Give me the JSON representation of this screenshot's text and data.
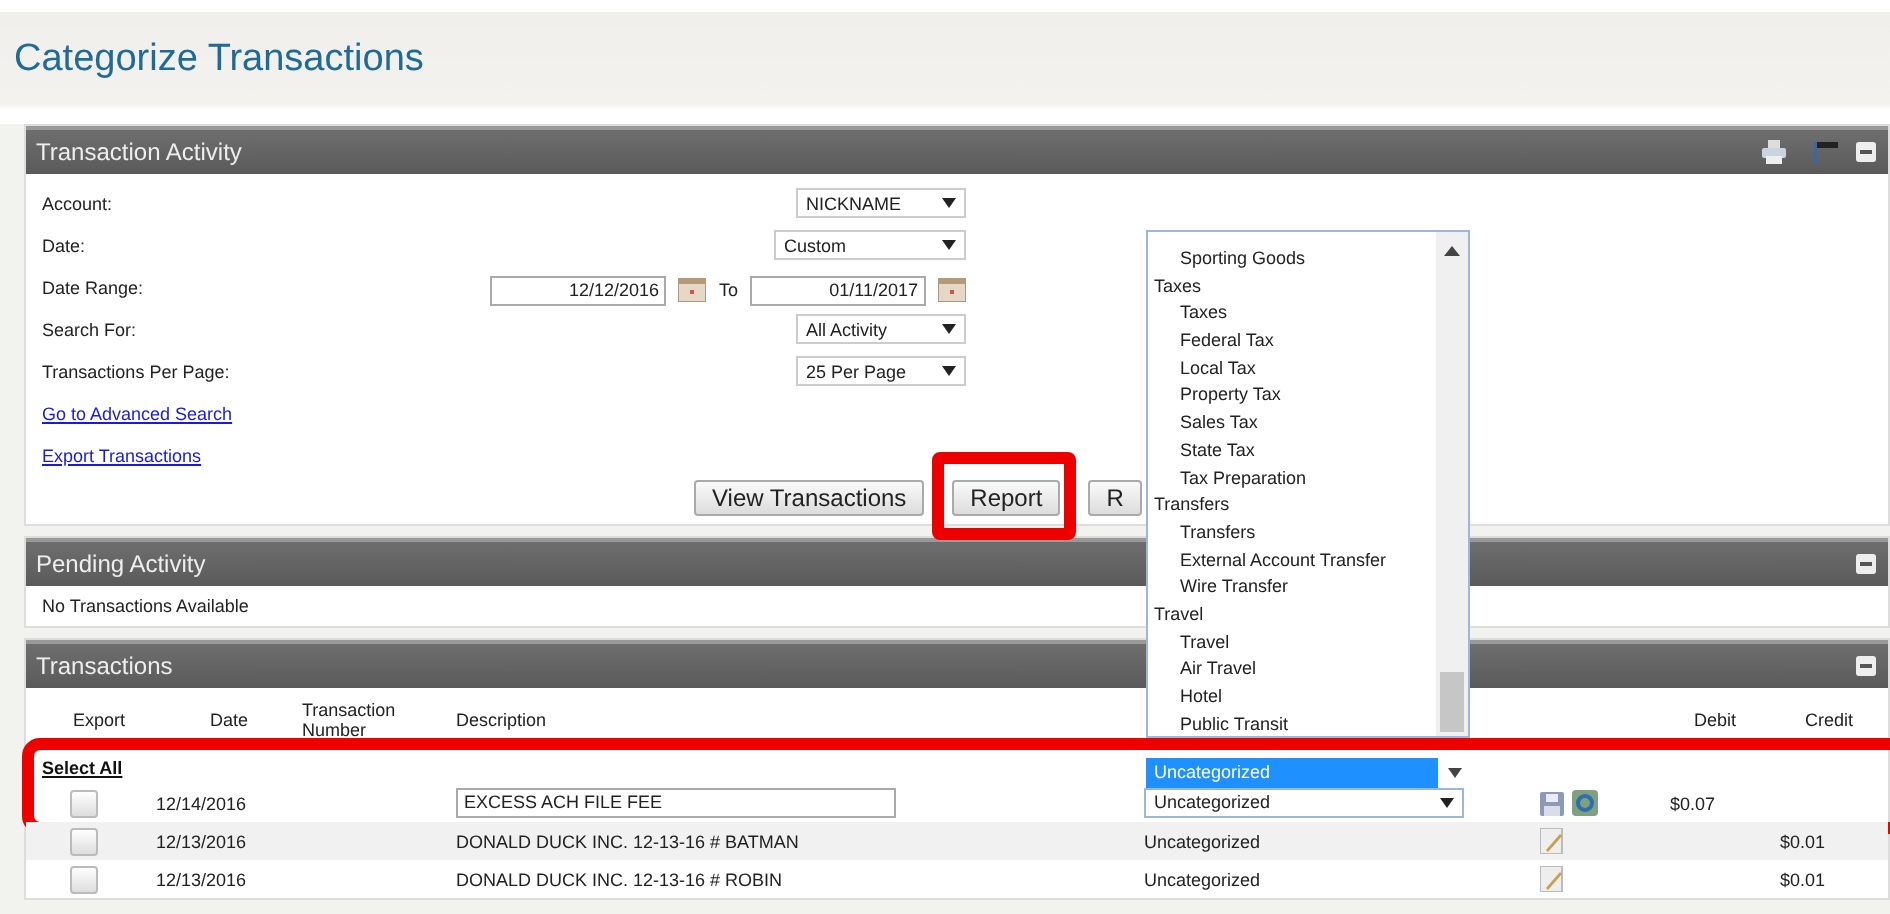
{
  "page_title": "Categorize Transactions",
  "activity": {
    "title": "Transaction Activity",
    "fields": [
      {
        "kind": "select",
        "label": "Account:",
        "value": "NICKNAME"
      },
      {
        "kind": "select",
        "label": "Date:",
        "value": "Custom"
      },
      {
        "kind": "range",
        "label": "Date Range:",
        "from": "12/12/2016",
        "connector": "To",
        "to": "01/11/2017"
      },
      {
        "kind": "select",
        "label": "Search For:",
        "value": "All Activity"
      },
      {
        "kind": "select",
        "label": "Transactions Per Page:",
        "value": "25 Per Page"
      }
    ],
    "links": [
      "Go to Advanced Search",
      "Export Transactions"
    ],
    "buttons": [
      {
        "label": "View Transactions",
        "highlighted": false
      },
      {
        "label": "Report",
        "highlighted": true
      },
      {
        "label": "R",
        "highlighted": false
      }
    ]
  },
  "pending": {
    "title": "Pending Activity",
    "message": "No Transactions Available"
  },
  "transactions": {
    "title": "Transactions",
    "columns": [
      "Export",
      "Date",
      "Transaction Number",
      "Description",
      "Debit",
      "Credit"
    ],
    "select_all": "Select All",
    "rows": [
      {
        "kind": "editing",
        "checked": false,
        "highlighted": true,
        "date": "12/14/2016",
        "description": "EXCESS ACH FILE FEE",
        "category": "Uncategorized",
        "debit": "$0.07"
      },
      {
        "kind": "plain",
        "checked": false,
        "highlighted": false,
        "date": "12/13/2016",
        "description": "DONALD DUCK INC. 12-13-16 # BATMAN",
        "category": "Uncategorized",
        "credit": "$0.01"
      },
      {
        "kind": "plain",
        "checked": false,
        "highlighted": false,
        "date": "12/13/2016",
        "description": "DONALD DUCK INC. 12-13-16 # ROBIN",
        "category": "Uncategorized",
        "credit": "$0.01"
      }
    ]
  },
  "category_dropdown": {
    "selected": "Uncategorized",
    "items": [
      {
        "kind": "option",
        "label": "Sporting Goods"
      },
      {
        "kind": "group",
        "label": "Taxes"
      },
      {
        "kind": "option",
        "label": "Taxes"
      },
      {
        "kind": "option",
        "label": "Federal Tax"
      },
      {
        "kind": "option",
        "label": "Local Tax"
      },
      {
        "kind": "option",
        "label": "Property Tax"
      },
      {
        "kind": "option",
        "label": "Sales Tax"
      },
      {
        "kind": "option",
        "label": "State Tax"
      },
      {
        "kind": "option",
        "label": "Tax Preparation"
      },
      {
        "kind": "group",
        "label": "Transfers"
      },
      {
        "kind": "option",
        "label": "Transfers"
      },
      {
        "kind": "option",
        "label": "External Account Transfer"
      },
      {
        "kind": "option",
        "label": "Wire Transfer"
      },
      {
        "kind": "group",
        "label": "Travel"
      },
      {
        "kind": "option",
        "label": "Travel"
      },
      {
        "kind": "option",
        "label": "Air Travel"
      },
      {
        "kind": "option",
        "label": "Hotel"
      },
      {
        "kind": "option",
        "label": "Public Transit"
      }
    ]
  }
}
